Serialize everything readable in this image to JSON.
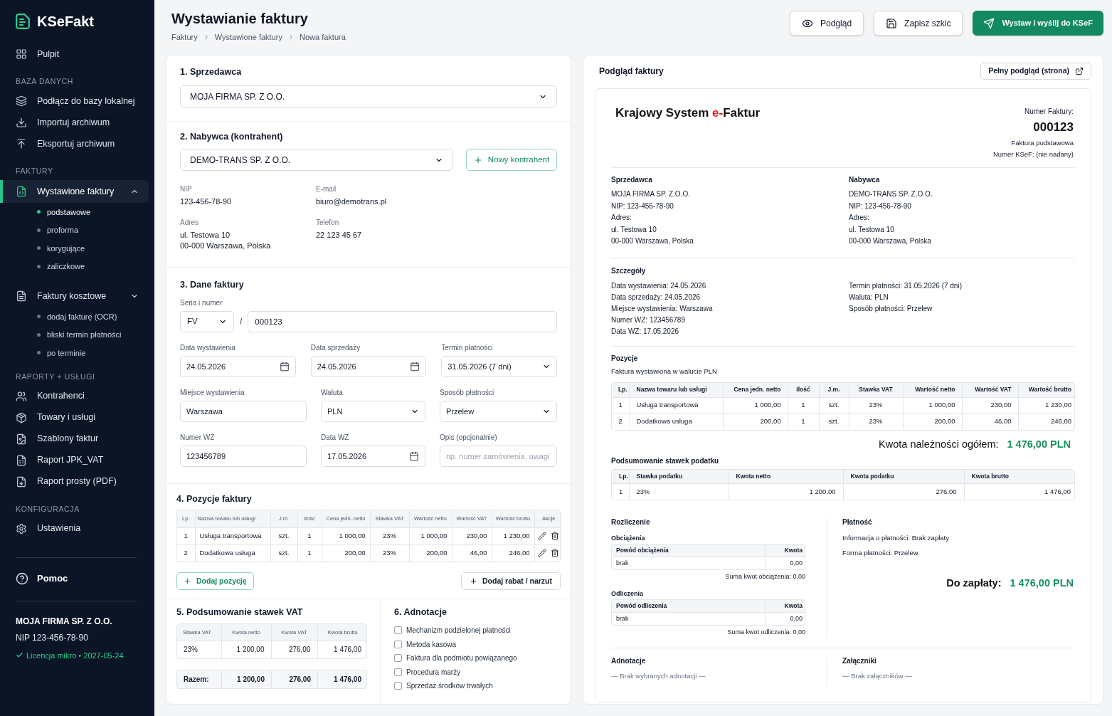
{
  "sidebar": {
    "brand": "KSeFakt",
    "nav": [
      {
        "kind": "link",
        "label": "Pulpit",
        "selected": false
      },
      {
        "kind": "heading",
        "label": "BAZA DANYCH"
      },
      {
        "kind": "link",
        "label": "Podłącz do bazy lokalnej",
        "selected": false
      },
      {
        "kind": "link",
        "label": "Importuj archiwum",
        "selected": false
      },
      {
        "kind": "link",
        "label": "Eksportuj archiwum",
        "selected": false
      },
      {
        "kind": "heading",
        "label": "FAKTURY"
      },
      {
        "kind": "group",
        "label": "Wystawione faktury",
        "selected": true,
        "expanded": true,
        "children": [
          {
            "label": "podstawowe",
            "selected": true
          },
          {
            "label": "proforma",
            "selected": false
          },
          {
            "label": "korygujące",
            "selected": false
          },
          {
            "label": "zaliczkowe",
            "selected": false
          }
        ]
      },
      {
        "kind": "group",
        "label": "Faktury kosztowe",
        "selected": false,
        "expanded": false,
        "children": [
          {
            "label": "dodaj fakturę (OCR)",
            "selected": false
          },
          {
            "label": "bliski termin płatności",
            "selected": false
          },
          {
            "label": "po terminie",
            "selected": false
          }
        ]
      },
      {
        "kind": "heading",
        "label": "RAPORTY + USŁUGI"
      },
      {
        "kind": "link",
        "label": "Kontrahenci",
        "selected": false
      },
      {
        "kind": "link",
        "label": "Towary i usługi",
        "selected": false
      },
      {
        "kind": "link",
        "label": "Szablony faktur",
        "selected": false
      },
      {
        "kind": "link",
        "label": "Raport JPK_VAT",
        "selected": false
      },
      {
        "kind": "link",
        "label": "Raport prosty (PDF)",
        "selected": false
      },
      {
        "kind": "heading",
        "label": "KONFIGURACJA"
      },
      {
        "kind": "link",
        "label": "Ustawienia",
        "selected": false
      }
    ],
    "help": "Pomoc",
    "company": {
      "name": "MOJA FIRMA SP. Z O.O.",
      "nip": "NIP 123-456-78-90",
      "license": "Licencja mikro • 2027-05-24"
    }
  },
  "header": {
    "title": "Wystawianie faktury",
    "breadcrumb": [
      "Faktury",
      "Wystawione faktury",
      "Nowa faktura"
    ],
    "actions": [
      {
        "label": "Podgląd",
        "kind": "secondary"
      },
      {
        "label": "Zapisz szkic",
        "kind": "secondary"
      },
      {
        "label": "Wystaw i wyślij do KSeF",
        "kind": "primary"
      }
    ]
  },
  "form": {
    "seller": {
      "heading": "1. Sprzedawca",
      "value": "MOJA FIRMA SP. Z O.O."
    },
    "buyer": {
      "heading": "2. Nabywca (kontrahent)",
      "value": "DEMO-TRANS SP. Z O.O.",
      "new_button": "Nowy kontrahent",
      "details": [
        {
          "label": "NIP",
          "lines": [
            "123-456-78-90"
          ]
        },
        {
          "label": "E-mail",
          "lines": [
            "biuro@demotrans.pl"
          ]
        },
        {
          "label": "Adres",
          "lines": [
            "ul. Testowa 10",
            "00-000 Warszawa, Polska"
          ]
        },
        {
          "label": "Telefon",
          "lines": [
            "22 123 45 67"
          ]
        }
      ]
    },
    "invoice": {
      "heading": "3. Dane faktury",
      "series_label": "Seria i numer",
      "series": "FV",
      "separator": "/",
      "number": "000123",
      "field_rows": [
        [
          {
            "label": "Data wystawienia",
            "kind": "date",
            "value": "24.05.2026"
          },
          {
            "label": "Data sprzedaży",
            "kind": "date",
            "value": "24.05.2026"
          },
          {
            "label": "Termin płatności",
            "kind": "select",
            "value": "31.05.2026 (7 dni)"
          }
        ],
        [
          {
            "label": "Miejsce wystawienia",
            "kind": "text",
            "value": "Warszawa"
          },
          {
            "label": "Waluta",
            "kind": "select",
            "value": "PLN"
          },
          {
            "label": "Sposób płatności",
            "kind": "select",
            "value": "Przelew"
          }
        ],
        [
          {
            "label": "Numer WZ",
            "kind": "text",
            "value": "123456789"
          },
          {
            "label": "Data WZ",
            "kind": "date",
            "value": "17.05.2026"
          },
          {
            "label": "Opis (opcjonalnie)",
            "kind": "text",
            "placeholder": "np. numer zamówienia, uwagi"
          }
        ]
      ]
    },
    "items": {
      "heading": "4. Pozycje faktury",
      "columns": [
        "Lp.",
        "Nazwa towaru lub usługi",
        "J.m.",
        "Ilość",
        "Cena jedn. netto",
        "Stawka VAT",
        "Wartość netto",
        "Wartość VAT",
        "Wartość brutto",
        "Akcje"
      ],
      "rows": [
        [
          "1",
          "Usługa transportowa",
          "szt.",
          "1",
          "1 000,00",
          "23%",
          "1 000,00",
          "230,00",
          "1 230,00"
        ],
        [
          "2",
          "Dodatkowa usługa",
          "szt.",
          "1",
          "200,00",
          "23%",
          "200,00",
          "46,00",
          "246,00"
        ]
      ],
      "add_button": "Dodaj pozycję",
      "discount_button": "Dodaj rabat / narzut"
    },
    "vat_summary": {
      "heading": "5. Podsumowanie stawek VAT",
      "columns": [
        "Stawka VAT",
        "Kwota netto",
        "Kwota VAT",
        "Kwota brutto"
      ],
      "rows": [
        [
          "23%",
          "1 200,00",
          "276,00",
          "1 476,00"
        ]
      ],
      "total": [
        "Razem:",
        "1 200,00",
        "276,00",
        "1 476,00"
      ]
    },
    "annotations": {
      "heading": "6. Adnotacje",
      "options": [
        {
          "label": "Mechanizm podzielonej płatności",
          "checked": false
        },
        {
          "label": "Metoda kasowa",
          "checked": false
        },
        {
          "label": "Faktura dla podmiotu powiązanego",
          "checked": false
        },
        {
          "label": "Procedura marży",
          "checked": false
        },
        {
          "label": "Sprzedaż środków trwałych",
          "checked": false
        }
      ]
    }
  },
  "preview": {
    "title": "Podgląd faktury",
    "full_button": "Pełny podgląd (strona)",
    "document": {
      "title_main": "Krajowy System",
      "title_accent": "e-",
      "title_end": "Faktur",
      "number_label": "Numer Faktury:",
      "number": "000123",
      "invoice_type": "Faktura podstawowa",
      "ksef_number": "Numer KSeF: (nie nadany)",
      "parties": [
        {
          "heading": "Sprzedawca",
          "lines": [
            "MOJA FIRMA SP. Z.O.O.",
            "NIP: 123-456-78-90",
            "Adres:",
            "ul. Testowa 10",
            "00-000 Warszawa, Polska"
          ]
        },
        {
          "heading": "Nabywca",
          "lines": [
            "DEMO-TRANS SP. Z.O.O.",
            "NIP: 123-456-78-90",
            "Adres:",
            "ul. Testowa 10",
            "00-000 Warszawa, Polska"
          ]
        }
      ],
      "details": {
        "heading": "Szczegóły",
        "columns": [
          [
            "Data wystawienia: 24.05.2026",
            "Data sprzedaży: 24.05.2026",
            "Miejsce wystawienia: Warszawa",
            "Numer WZ: 123456789",
            "Data WZ: 17.05.2026"
          ],
          [
            "Termin płatności: 31.05.2026 (7 dni)",
            "Waluta: PLN",
            "Sposób płatności: Przelew"
          ]
        ]
      },
      "positions": {
        "heading": "Pozycje",
        "note": "Faktura wystawiona w walucie PLN",
        "columns": [
          "Lp.",
          "Nazwa towaru lub usługi",
          "Cena jedn. netto",
          "Ilość",
          "J.m.",
          "Stawka VAT",
          "Wartość netto",
          "Wartość VAT",
          "Wartość brutto"
        ],
        "rows": [
          [
            "1",
            "Usługa transportowa",
            "1 000,00",
            "1",
            "szt.",
            "23%",
            "1 000,00",
            "230,00",
            "1 230,00"
          ],
          [
            "2",
            "Dodatkowa usługa",
            "200,00",
            "1",
            "szt.",
            "23%",
            "200,00",
            "46,00",
            "246,00"
          ]
        ]
      },
      "total": {
        "label": "Kwota należności ogółem:",
        "value": "1 476,00 PLN"
      },
      "tax_summary": {
        "heading": "Podsumowanie stawek podatku",
        "columns": [
          "Lp.",
          "Stawka podatku",
          "Kwota netto",
          "Kwota podatku",
          "Kwota brutto"
        ],
        "rows": [
          [
            "1",
            "23%",
            "1 200,00",
            "276,00",
            "1 476,00"
          ]
        ]
      },
      "settlement": {
        "heading": "Rozliczenie",
        "blocks": [
          {
            "heading": "Obciążenia",
            "columns": [
              "Powód obciążenia",
              "Kwota"
            ],
            "rows": [
              [
                "brak",
                "0,00"
              ]
            ],
            "sum": "Suma kwot obciążenia: 0,00"
          },
          {
            "heading": "Odliczenia",
            "columns": [
              "Powód odliczenia",
              "Kwota"
            ],
            "rows": [
              [
                "brak",
                "0,00"
              ]
            ],
            "sum": "Suma kwot odliczenia: 0,00"
          }
        ]
      },
      "payment": {
        "heading": "Płatność",
        "lines": [
          "Informacja o płatności: Brak zapłaty",
          "Forma płatności: Przelew"
        ],
        "due": {
          "label": "Do zapłaty:",
          "value": "1 476,00 PLN"
        }
      },
      "footer": [
        {
          "heading": "Adnotacje",
          "note": "— Brak wybranych adnotacji —"
        },
        {
          "heading": "Załączniki",
          "note": "— Brak załączników —"
        }
      ]
    }
  }
}
